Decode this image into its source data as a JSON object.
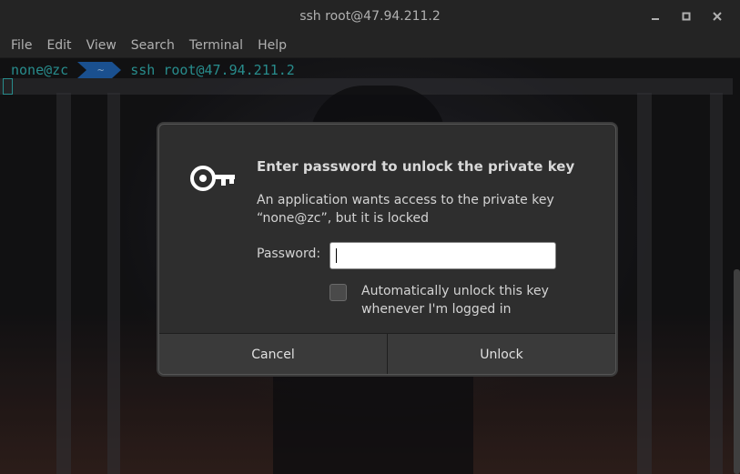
{
  "window": {
    "title": "ssh root@47.94.211.2",
    "minimize_label": "–",
    "maximize_label": "□",
    "close_label": "✕"
  },
  "menu": {
    "items": [
      "File",
      "Edit",
      "View",
      "Search",
      "Terminal",
      "Help"
    ]
  },
  "terminal": {
    "prompt_user": "none@zc",
    "prompt_dir": "~",
    "command": "ssh root@47.94.211.2",
    "accent_color": "#2fa5a5"
  },
  "dialog": {
    "title": "Enter password to unlock the private key",
    "message_line1": "An application wants access to the private key",
    "message_line2": "“none@zc”, but it is locked",
    "password_label": "Password:",
    "password_value": "",
    "checkbox_label_line1": "Automatically unlock this key",
    "checkbox_label_line2": "whenever I'm logged in",
    "checkbox_checked": false,
    "cancel_label": "Cancel",
    "unlock_label": "Unlock",
    "icon": "key-icon"
  }
}
